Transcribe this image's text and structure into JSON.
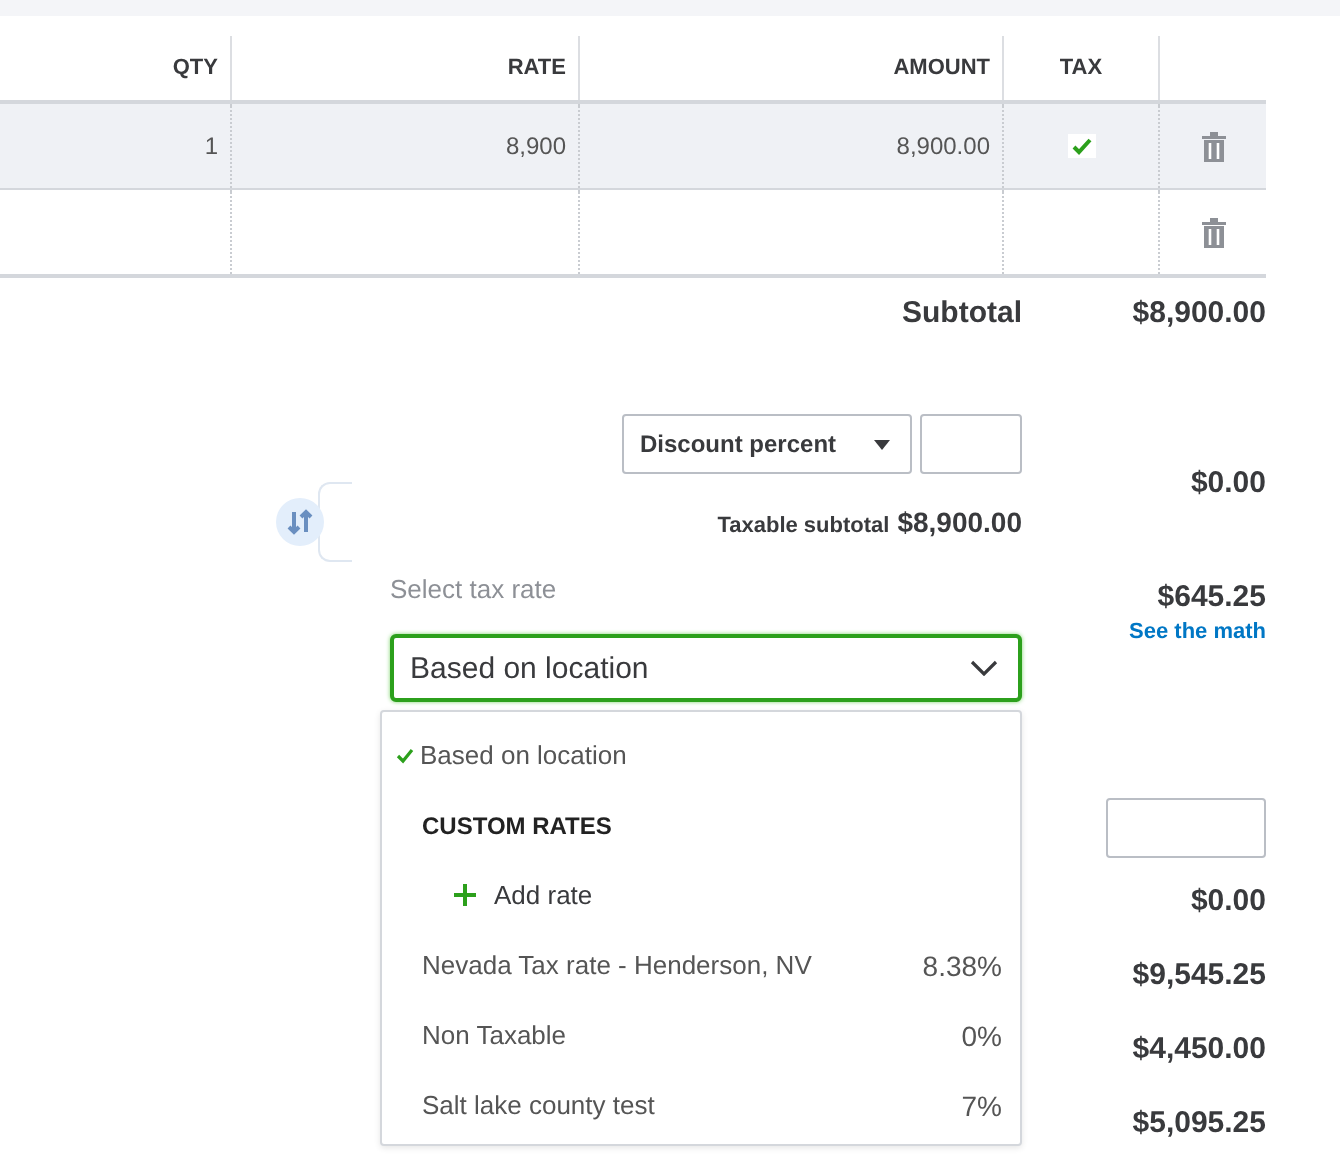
{
  "table": {
    "columns": [
      "QTY",
      "RATE",
      "AMOUNT",
      "TAX"
    ],
    "rows": [
      {
        "qty": "1",
        "rate": "8,900",
        "amount": "8,900.00",
        "taxable": true,
        "highlighted": true
      },
      {
        "taxable": false,
        "highlighted": false
      }
    ]
  },
  "summary": {
    "subtotal_label": "Subtotal",
    "subtotal_value": "$8,900.00",
    "discount": {
      "type": "Discount percent",
      "amount": "$0.00"
    },
    "taxable_subtotal_label": "Taxable subtotal",
    "taxable_subtotal_value": "$8,900.00",
    "tax_rate": {
      "label": "Select tax rate",
      "value": "Based on location",
      "amount": "$645.25",
      "link": "See the math"
    },
    "dropdown": [
      {
        "kind": "option",
        "label": "Based on location",
        "selected": true
      },
      {
        "kind": "header",
        "label": "CUSTOM RATES"
      },
      {
        "kind": "add",
        "label": "Add rate"
      },
      {
        "kind": "rate",
        "label": "Nevada Tax rate - Henderson, NV",
        "rate": "8.38%",
        "selected": false
      },
      {
        "kind": "rate",
        "label": "Non Taxable",
        "rate": "0%",
        "selected": false
      },
      {
        "kind": "rate",
        "label": "Salt lake county test",
        "rate": "7%",
        "selected": false
      }
    ],
    "amounts": [
      "$0.00",
      "$9,545.25",
      "$4,450.00",
      "$5,095.25"
    ]
  }
}
